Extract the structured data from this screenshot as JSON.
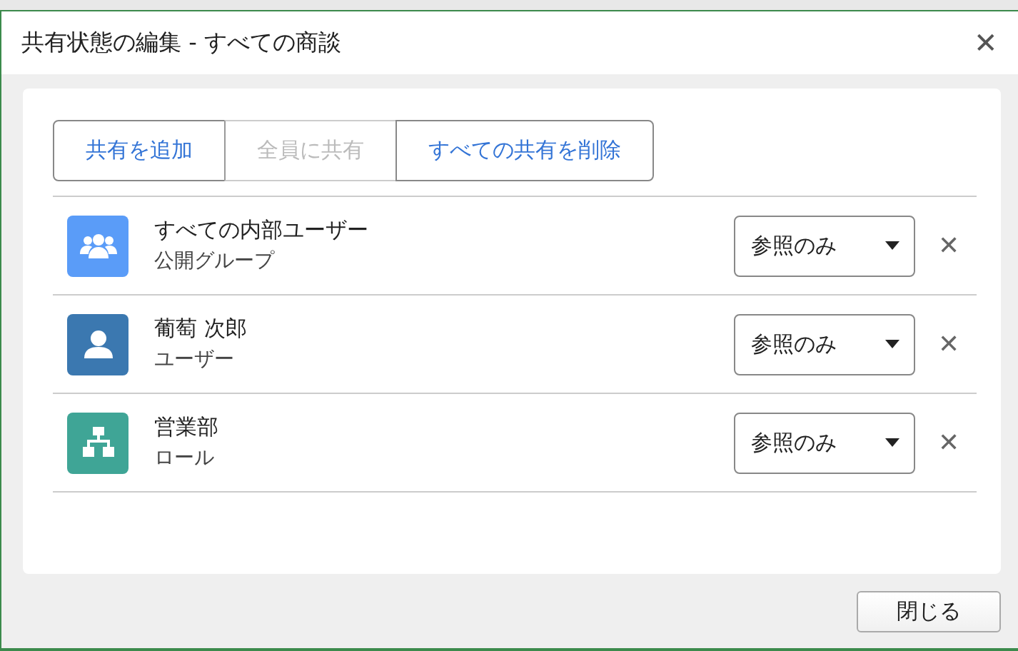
{
  "window": {
    "title": "共有状態の編集 - すべての商談",
    "close": "✕"
  },
  "actions": [
    {
      "label": "共有を追加",
      "disabled": false
    },
    {
      "label": "全員に共有",
      "disabled": true
    },
    {
      "label": "すべての共有を削除",
      "disabled": false
    }
  ],
  "shares": [
    {
      "kind": "group",
      "color": "#5a9cf8",
      "name": "すべての内部ユーザー",
      "type": "公開グループ",
      "access": "参照のみ",
      "remove": "✕"
    },
    {
      "kind": "user",
      "color": "#3b78b0",
      "name": "葡萄 次郎",
      "type": "ユーザー",
      "access": "参照のみ",
      "remove": "✕"
    },
    {
      "kind": "role",
      "color": "#3fa596",
      "name": "営業部",
      "type": "ロール",
      "access": "参照のみ",
      "remove": "✕"
    }
  ],
  "footer": {
    "close_button": "閉じる"
  }
}
